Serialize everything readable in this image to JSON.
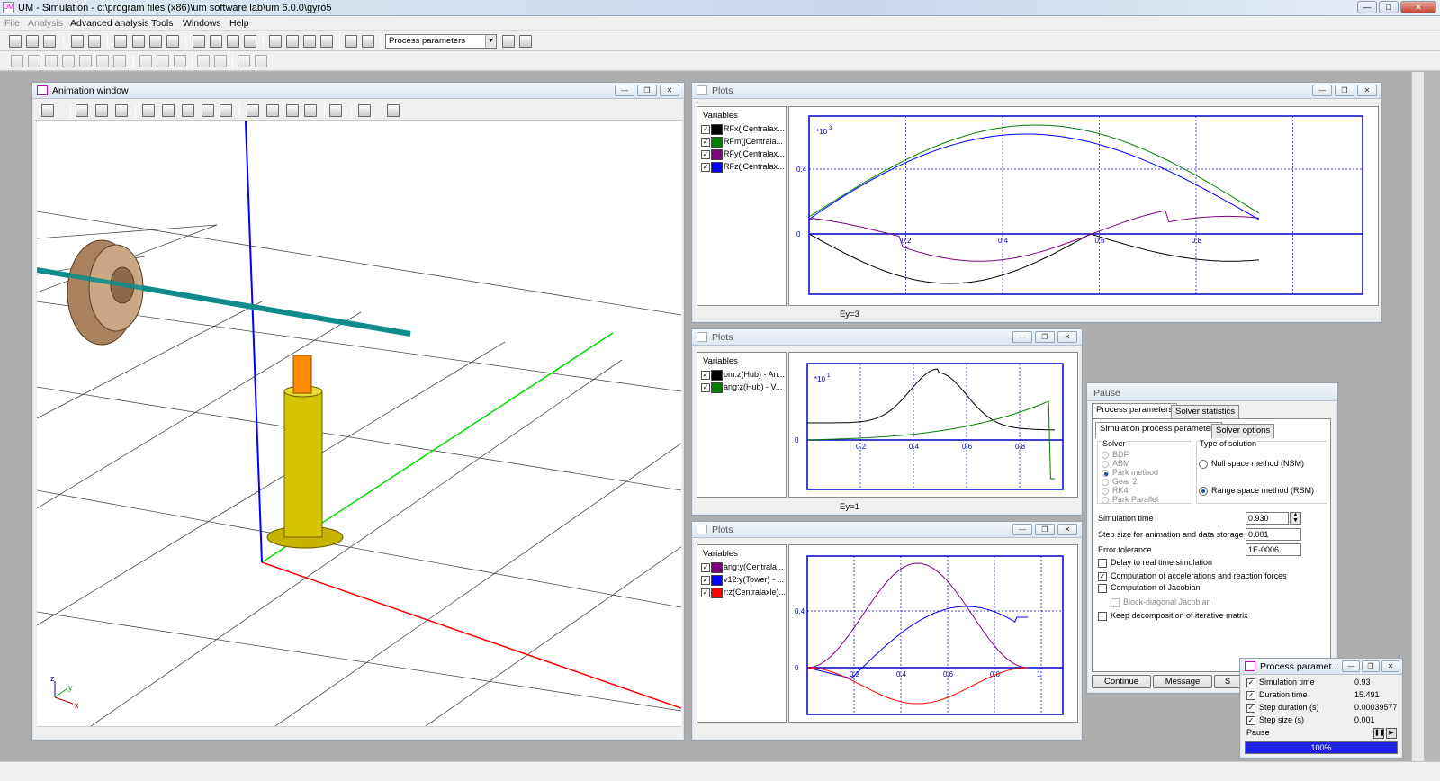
{
  "app": {
    "title": "UM - Simulation - c:\\program files (x86)\\um software lab\\um 6.0.0\\gyro5",
    "icon_label": "UM"
  },
  "menu": [
    "File",
    "Analysis",
    "Advanced analysis",
    "Tools",
    "Windows",
    "Help"
  ],
  "toolbar": {
    "combo_value": "Process parameters"
  },
  "animation_window": {
    "title": "Animation window",
    "axis_labels": {
      "z": "z",
      "y": "y",
      "x": "x"
    }
  },
  "plots": [
    {
      "title": "Plots",
      "variables_header": "Variables",
      "variables": [
        {
          "label": "RFx(jCentralax...",
          "color": "#000000",
          "checked": true
        },
        {
          "label": "RFm(jCentrala...",
          "color": "#008000",
          "checked": true
        },
        {
          "label": "RFy(jCentralax...",
          "color": "#800080",
          "checked": true
        },
        {
          "label": "RFz(jCentralax...",
          "color": "#0000ff",
          "checked": true
        }
      ],
      "scale_label": "*10",
      "scale_exp": "3",
      "y_ticks": [
        "0.4",
        "0"
      ],
      "x_ticks": [
        "0.2",
        "0.4",
        "0.6",
        "0.8"
      ],
      "status": "Ey=3"
    },
    {
      "title": "Plots",
      "variables_header": "Variables",
      "variables": [
        {
          "label": "om:z(Hub) - An...",
          "color": "#000000",
          "checked": true
        },
        {
          "label": "ang:z(Hub) - V...",
          "color": "#008000",
          "checked": true
        }
      ],
      "scale_label": "*10",
      "scale_exp": "1",
      "y_ticks": [
        "0"
      ],
      "x_ticks": [
        "0.2",
        "0.4",
        "0.6",
        "0.8"
      ],
      "status": "Ey=1"
    },
    {
      "title": "Plots",
      "variables_header": "Variables",
      "variables": [
        {
          "label": "ang:y(Centrala...",
          "color": "#800080",
          "checked": true
        },
        {
          "label": "v12:y(Tower) - ...",
          "color": "#0000ff",
          "checked": true
        },
        {
          "label": "r:z(Centralaxle)...",
          "color": "#ff0000",
          "checked": true
        }
      ],
      "y_ticks": [
        "0.4",
        "0"
      ],
      "x_ticks": [
        "0.2",
        "0.4",
        "0.6",
        "0.8",
        "1"
      ],
      "status": ""
    }
  ],
  "pause_dialog": {
    "title": "Pause",
    "tabs": [
      "Process parameters",
      "Solver statistics"
    ],
    "subtabs": [
      "Simulation process parameters",
      "Solver options"
    ],
    "solver_group": "Solver",
    "solvers": [
      {
        "label": "BDF",
        "selected": false
      },
      {
        "label": "ABM",
        "selected": false
      },
      {
        "label": "Park method",
        "selected": true
      },
      {
        "label": "Gear 2",
        "selected": false
      },
      {
        "label": "RK4",
        "selected": false
      },
      {
        "label": "Park Parallel",
        "selected": false
      }
    ],
    "solution_group": "Type of solution",
    "solution_types": [
      {
        "label": "Null space method (NSM)",
        "selected": false
      },
      {
        "label": "Range space method (RSM)",
        "selected": true
      }
    ],
    "fields": [
      {
        "label": "Simulation time",
        "value": "0.930"
      },
      {
        "label": "Step size for animation and data storage",
        "value": "0.001"
      },
      {
        "label": "Error tolerance",
        "value": "1E-0006"
      }
    ],
    "checks": [
      {
        "label": "Delay to real time simulation",
        "checked": false,
        "enabled": true
      },
      {
        "label": "Computation of accelerations and reaction forces",
        "checked": true,
        "enabled": true
      },
      {
        "label": "Computation of Jacobian",
        "checked": false,
        "enabled": true
      },
      {
        "label": "Block-diagonal Jacobian",
        "checked": false,
        "enabled": false
      },
      {
        "label": "Keep decomposition of iterative matrix",
        "checked": false,
        "enabled": true
      }
    ],
    "buttons": [
      "Continue",
      "Message",
      "S"
    ]
  },
  "process_params_window": {
    "title": "Process paramet...",
    "rows": [
      {
        "label": "Simulation time",
        "value": "0.93",
        "checked": true
      },
      {
        "label": "Duration time",
        "value": "15.491",
        "checked": true
      },
      {
        "label": "Step duration (s)",
        "value": "0.00039577",
        "checked": true
      },
      {
        "label": "Step size (s)",
        "value": "0.001",
        "checked": true
      }
    ],
    "state": "Pause",
    "progress": 1.0,
    "progress_label": "100%"
  }
}
